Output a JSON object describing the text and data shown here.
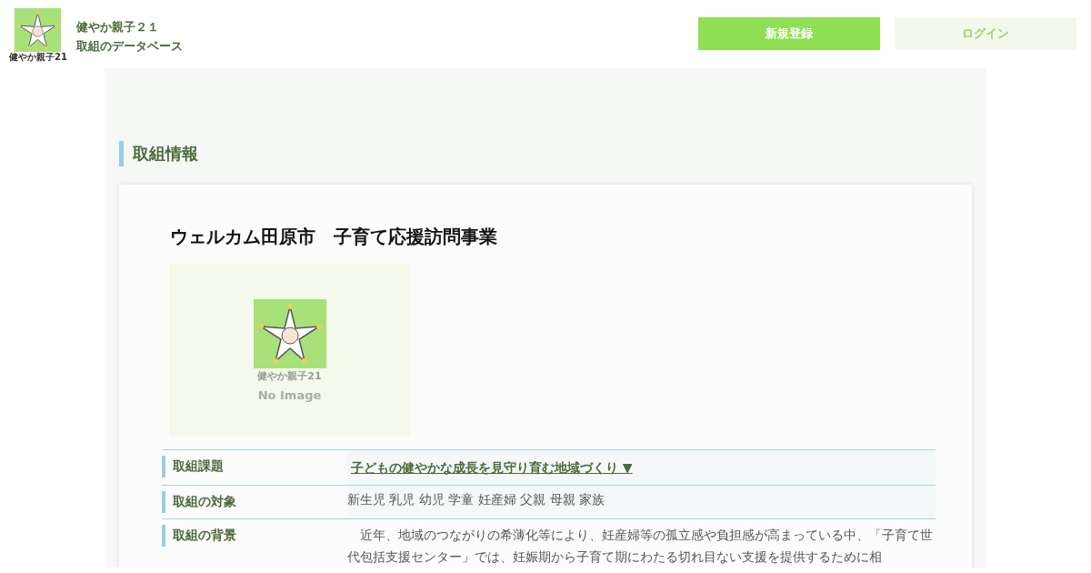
{
  "site": {
    "logo_text": "健やか親子21",
    "title_line1": "健やか親子２１",
    "title_line2": "取組のデータベース"
  },
  "header_buttons": [
    {
      "label": "新規登録",
      "kind": "primary"
    },
    {
      "label": "ログイン",
      "kind": "secondary"
    }
  ],
  "section_title": "取組情報",
  "card": {
    "title": "ウェルカム田原市　子育て応援訪問事業",
    "image": {
      "logo_text": "健やか親子21",
      "caption": "No Image"
    },
    "rows": [
      {
        "label": "取組課題",
        "kind": "link",
        "value": "子どもの健やかな成長を見守り育む地域づくり ▼"
      },
      {
        "label": "取組の対象",
        "kind": "text",
        "value": "新生児 乳児 幼児 学童 妊産婦 父親 母親 家族"
      },
      {
        "label": "取組の背景",
        "kind": "paragraph",
        "value": "近年、地域のつながりの希薄化等により、妊産婦等の孤立感や負担感が高まっている中、「子育て世代包括支援センター」では、妊娠期から子育て期にわたる切れ目ない支援を提供するために相"
      }
    ]
  }
}
